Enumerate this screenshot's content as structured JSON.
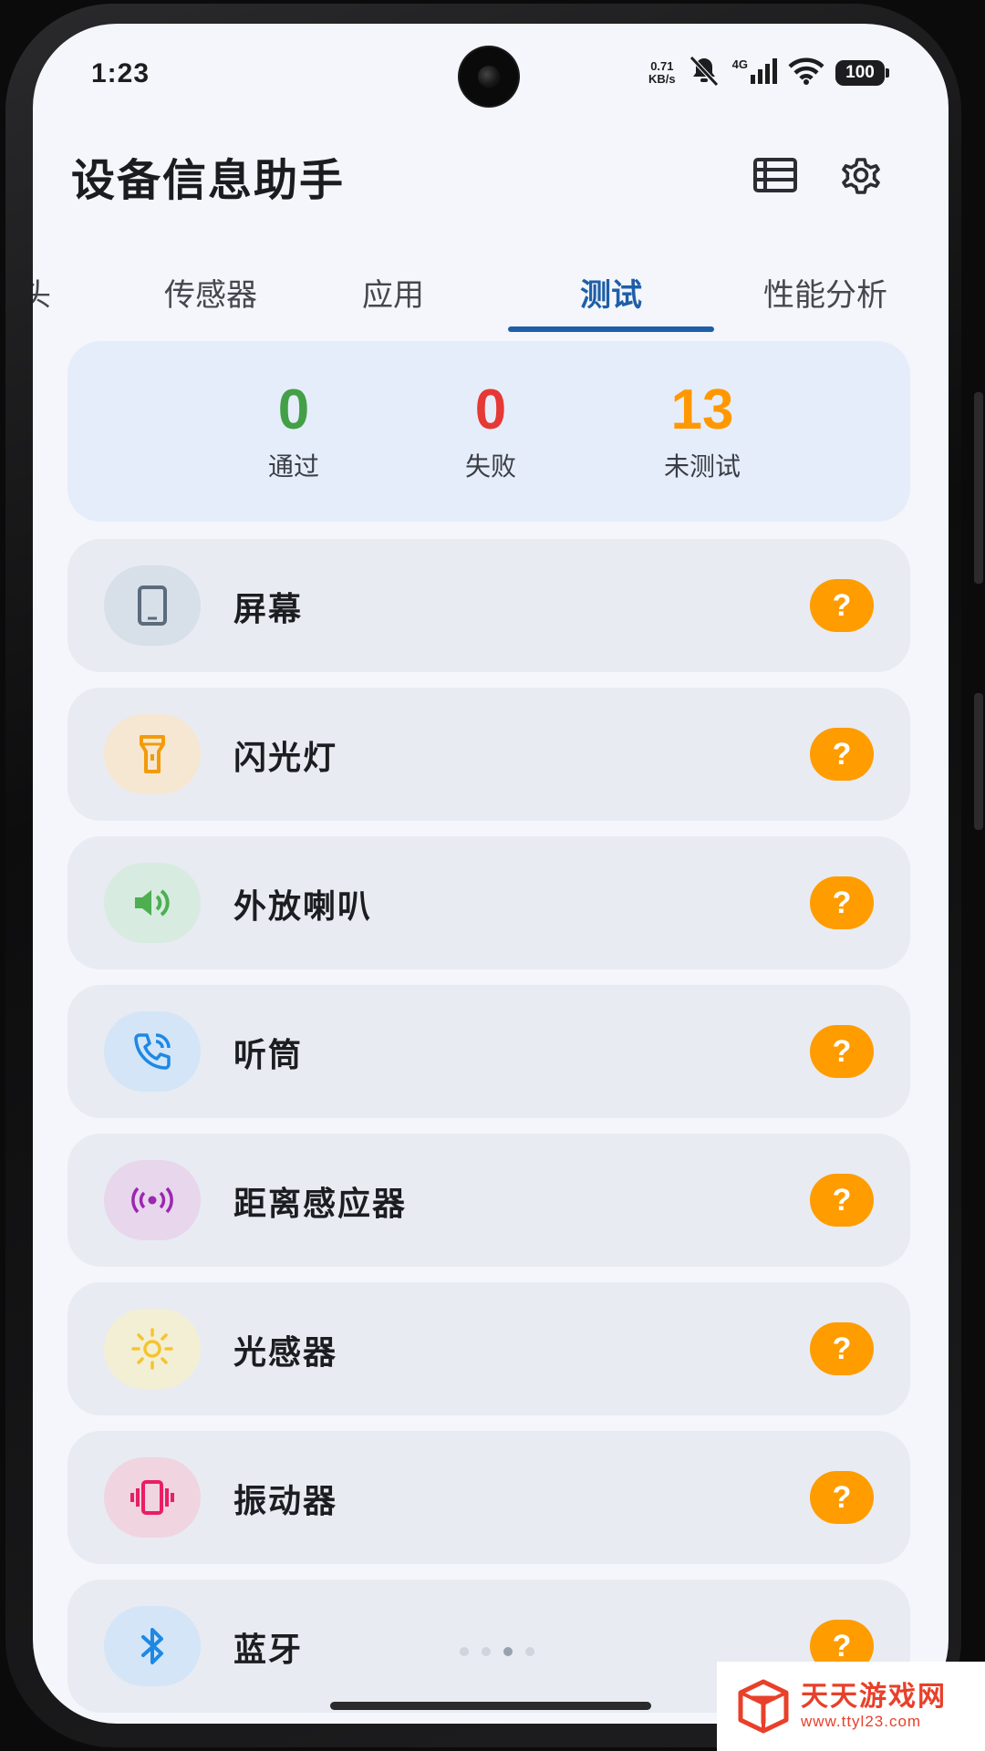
{
  "status_bar": {
    "time": "1:23",
    "net_speed_value": "0.71",
    "net_speed_unit": "KB/s",
    "network_type": "4G",
    "battery": "100",
    "icons": [
      "mute-bell-icon",
      "signal-icon",
      "wifi-icon",
      "battery-icon"
    ]
  },
  "header": {
    "title": "设备信息助手",
    "icons": [
      "list-view-icon",
      "settings-gear-icon"
    ]
  },
  "tabs": [
    {
      "label": "头"
    },
    {
      "label": "传感器"
    },
    {
      "label": "应用"
    },
    {
      "label": "测试",
      "active": true
    },
    {
      "label": "性能分析"
    }
  ],
  "summary": {
    "passed": {
      "value": "0",
      "label": "通过",
      "color": "#43a047"
    },
    "failed": {
      "value": "0",
      "label": "失败",
      "color": "#e53935"
    },
    "untested": {
      "value": "13",
      "label": "未测试",
      "color": "#ff9800"
    }
  },
  "tests": [
    {
      "label": "屏幕",
      "icon": "phone-screen-icon",
      "icon_color": "#5b6b7c",
      "icon_bg": "#d7dfe8",
      "status": "?"
    },
    {
      "label": "闪光灯",
      "icon": "flashlight-icon",
      "icon_color": "#f29b0c",
      "icon_bg": "#f6e7d2",
      "status": "?"
    },
    {
      "label": "外放喇叭",
      "icon": "speaker-icon",
      "icon_color": "#4caf50",
      "icon_bg": "#d8ebe0",
      "status": "?"
    },
    {
      "label": "听筒",
      "icon": "phone-call-icon",
      "icon_color": "#1e88e5",
      "icon_bg": "#d3e5f6",
      "status": "?"
    },
    {
      "label": "距离感应器",
      "icon": "proximity-sensor-icon",
      "icon_color": "#9c27b0",
      "icon_bg": "#e7d6ec",
      "status": "?"
    },
    {
      "label": "光感器",
      "icon": "sun-icon",
      "icon_color": "#f4c430",
      "icon_bg": "#f3efd4",
      "status": "?"
    },
    {
      "label": "振动器",
      "icon": "vibrate-icon",
      "icon_color": "#e91e63",
      "icon_bg": "#f0d4e0",
      "status": "?"
    },
    {
      "label": "蓝牙",
      "icon": "bluetooth-icon",
      "icon_color": "#1e88e5",
      "icon_bg": "#d3e5f6",
      "status": "?"
    }
  ],
  "status_colors": {
    "untested_badge": "#ff9c00",
    "active_tab": "#1e5fa8"
  },
  "page_indicator": {
    "count": 4,
    "active": 2
  },
  "watermark": {
    "title": "天天游戏网",
    "url": "www.ttyl23.com"
  }
}
